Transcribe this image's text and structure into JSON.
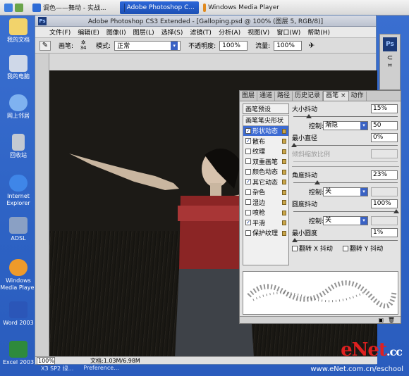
{
  "taskbar": {
    "items": [
      {
        "label": "调色——舞动 - 实战...",
        "active": false
      },
      {
        "label": "Adobe Photoshop C...",
        "active": true
      },
      {
        "label": "Windows Media Player",
        "active": false
      }
    ]
  },
  "desktop_icons": [
    {
      "label": "我的文档",
      "icon": "folder-icon"
    },
    {
      "label": "我的电脑",
      "icon": "computer-icon"
    },
    {
      "label": "网上邻居",
      "icon": "network-icon"
    },
    {
      "label": "回收站",
      "icon": "recycle-bin-icon"
    },
    {
      "label": "Internet Explorer",
      "icon": "ie-icon"
    },
    {
      "label": "ADSL",
      "icon": "adsl-icon"
    },
    {
      "label": "Windows Media Player",
      "icon": "media-player-icon"
    },
    {
      "label": "Word 2003",
      "icon": "word-icon"
    },
    {
      "label": "Excel 2003",
      "icon": "excel-icon"
    }
  ],
  "window": {
    "title": "Adobe Photoshop CS3 Extended - [Galloping.psd @ 100% (图层 5, RGB/8)]",
    "logo": "Ps",
    "menu": [
      "文件(F)",
      "编辑(E)",
      "图像(I)",
      "图层(L)",
      "选择(S)",
      "滤镜(T)",
      "分析(A)",
      "视图(V)",
      "窗口(W)",
      "帮助(H)"
    ],
    "options": {
      "brush_label": "画笔:",
      "brush_size": "34",
      "mode_label": "模式:",
      "mode_value": "正常",
      "opacity_label": "不透明度:",
      "opacity_value": "100%",
      "flow_label": "流量:",
      "flow_value": "100%"
    },
    "status": {
      "zoom": "100%",
      "doc": "文档:1.03M/6.98M"
    }
  },
  "panel": {
    "tabs": [
      "图层",
      "通道",
      "路径",
      "历史记录",
      "画笔",
      "动作"
    ],
    "active_tab": "画笔",
    "presets_label": "画笔预设",
    "list": [
      {
        "label": "画笔笔尖形状",
        "checkbox": false,
        "selected": false,
        "header": true
      },
      {
        "label": "形状动态",
        "checked": true,
        "selected": true
      },
      {
        "label": "散布",
        "checked": true,
        "selected": false
      },
      {
        "label": "纹理",
        "checked": false,
        "selected": false
      },
      {
        "label": "双重画笔",
        "checked": false,
        "selected": false
      },
      {
        "label": "颜色动态",
        "checked": false,
        "selected": false
      },
      {
        "label": "其它动态",
        "checked": true,
        "selected": false
      },
      {
        "label": "杂色",
        "checked": false,
        "selected": false
      },
      {
        "label": "湿边",
        "checked": false,
        "selected": false
      },
      {
        "label": "喷枪",
        "checked": false,
        "selected": false
      },
      {
        "label": "平滑",
        "checked": true,
        "selected": false
      },
      {
        "label": "保护纹理",
        "checked": false,
        "selected": false
      }
    ],
    "size_jitter_label": "大小抖动",
    "size_jitter_value": "15%",
    "control_label": "控制:",
    "size_control": "渐隐",
    "size_control_value": "50",
    "min_diameter_label": "最小直径",
    "min_diameter_value": "0%",
    "tilt_scale_label": "倾斜缩放比例",
    "angle_jitter_label": "角度抖动",
    "angle_jitter_value": "23%",
    "angle_control": "关",
    "roundness_jitter_label": "圆度抖动",
    "roundness_jitter_value": "100%",
    "roundness_control": "关",
    "min_roundness_label": "最小圆度",
    "min_roundness_value": "1%",
    "flip_x_label": "翻转 X 抖动",
    "flip_y_label": "翻转 Y 抖动"
  },
  "watermark": {
    "brand": "eNet",
    "suffix": ".cc",
    "site": "www.eNet.com.cn/eschool"
  },
  "bottom_tasks": [
    "X3 SP2 绿...",
    "Preference..."
  ]
}
